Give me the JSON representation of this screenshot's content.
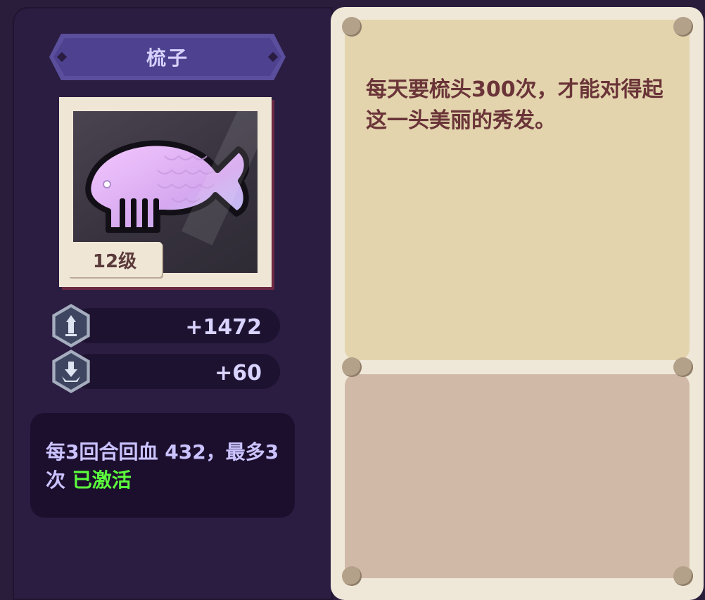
{
  "item": {
    "name": "梳子",
    "level": "12级",
    "icon": "fish-comb-icon"
  },
  "stats": [
    {
      "icon": "attack-up-icon",
      "value": "+1472"
    },
    {
      "icon": "defense-down-icon",
      "value": "+60"
    }
  ],
  "effect": {
    "text": "每3回合回血 432，最多3次",
    "status": "已激活"
  },
  "description": {
    "text": "每天要梳头300次，才能对得起这一头美丽的秀发。"
  },
  "colors": {
    "background": "#2b1d41",
    "banner": "#4d4190",
    "status_active": "#5cff3c",
    "description_panel": "#e3d4ad",
    "lower_panel": "#d1b9a8"
  }
}
